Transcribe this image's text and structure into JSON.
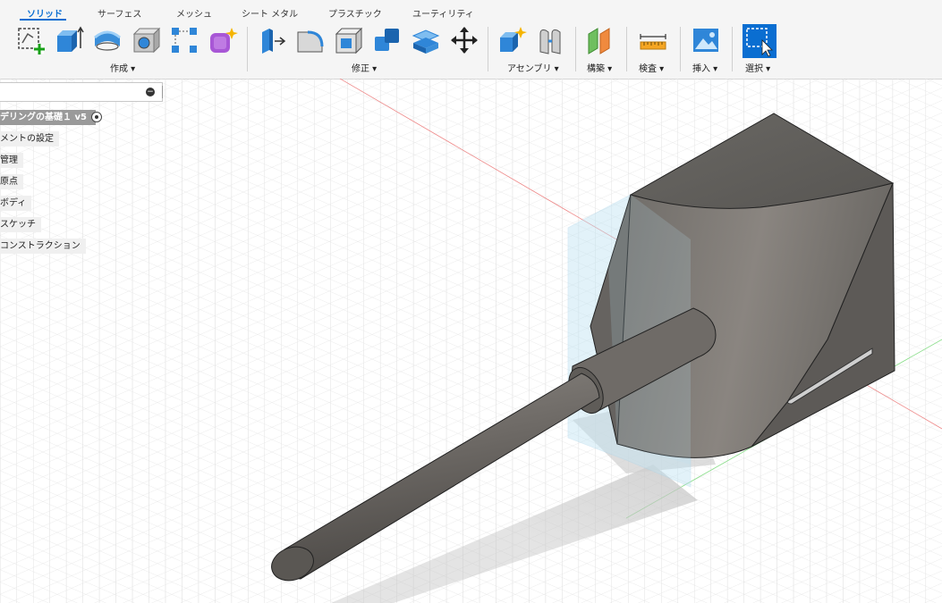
{
  "tabs": [
    {
      "label": "ソリッド",
      "active": true
    },
    {
      "label": "サーフェス"
    },
    {
      "label": "メッシュ"
    },
    {
      "label": "シート メタル"
    },
    {
      "label": "プラスチック"
    },
    {
      "label": "ユーティリティ"
    }
  ],
  "groups": {
    "create": "作成 ▾",
    "modify": "修正 ▾",
    "assemble": "アセンブリ ▾",
    "construct": "構築 ▾",
    "inspect": "検査 ▾",
    "insert": "挿入 ▾",
    "select": "選択 ▾"
  },
  "tools": {
    "create": [
      "create-sketch-icon",
      "extrude-icon",
      "revolve-icon",
      "hole-icon",
      "pattern-icon",
      "create-form-icon"
    ],
    "modify": [
      "press-pull-icon",
      "fillet-icon",
      "shell-icon",
      "combine-icon",
      "offset-face-icon",
      "move-icon"
    ],
    "assemble": [
      "new-component-icon",
      "joint-icon"
    ],
    "construct": [
      "offset-plane-icon"
    ],
    "inspect": [
      "measure-icon"
    ],
    "insert": [
      "insert-image-icon"
    ],
    "select": [
      "select-icon"
    ]
  },
  "browser": {
    "root": "デリングの基礎１ v5",
    "items": [
      "メントの設定",
      "管理",
      "原点",
      "ボディ",
      "スケッチ",
      "コンストラクション"
    ]
  },
  "colors": {
    "accent": "#0a6ed1",
    "body": "#76726e",
    "body_dark": "#5a5753",
    "grid": "#dcdcdc",
    "plane": "#bfe3f2"
  }
}
